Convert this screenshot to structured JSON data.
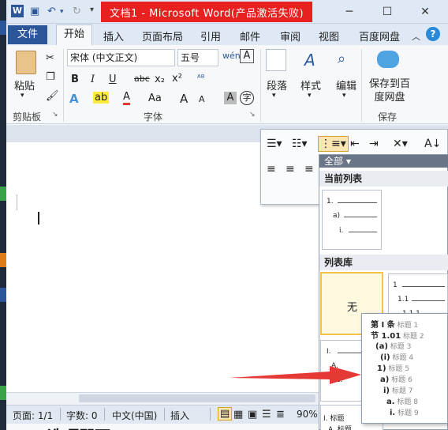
{
  "window": {
    "title": "文档1 - Microsoft Word(产品激活失败)"
  },
  "tabs": {
    "file": "文件",
    "home": "开始",
    "insert": "插入",
    "layout": "页面布局",
    "references": "引用",
    "mailings": "邮件",
    "review": "审阅",
    "view": "视图",
    "baidu": "百度网盘"
  },
  "clipboard": {
    "paste": "粘贴",
    "group": "剪贴板"
  },
  "font": {
    "name": "宋体 (中文正文)",
    "size": "五号",
    "group": "字体",
    "bold": "B",
    "italic": "I",
    "underline": "U",
    "strike": "abc",
    "sub": "x₂",
    "sup": "x²",
    "case": "Aa",
    "grow": "A",
    "shrink": "A",
    "char_border": "A",
    "enclose": "字"
  },
  "groups": {
    "paragraph": "段落",
    "styles": "样式",
    "editing": "编辑",
    "save_baidu": "保存到百度网盘",
    "save_group": "保存"
  },
  "dropdown": {
    "filter": "全部",
    "current_section": "当前列表",
    "library_section": "列表库",
    "none": "无",
    "current_preview": [
      "1.",
      "a)",
      "i."
    ],
    "lib2_preview": [
      "1",
      "1.1",
      "1.1.1"
    ],
    "lib3_preview": [
      "I.",
      "A.",
      "1."
    ],
    "lib4_preview": [
      "I. 标题",
      "A. 标题"
    ]
  },
  "flyout": {
    "lines": [
      {
        "num": "第 Ⅰ 条",
        "label": "标题 1"
      },
      {
        "num": "节 1.01",
        "label": "标题 2"
      },
      {
        "num": "(a)",
        "label": "标题 3"
      },
      {
        "num": "(i)",
        "label": "标题 4"
      },
      {
        "num": "1)",
        "label": "标题 5"
      },
      {
        "num": "a)",
        "label": "标题 6"
      },
      {
        "num": "i)",
        "label": "标题 7"
      },
      {
        "num": "a.",
        "label": "标题 8"
      },
      {
        "num": "i.",
        "label": "标题 9"
      }
    ]
  },
  "status": {
    "page": "页面: 1/1",
    "words": "字数: 0",
    "lang": "中文(中国)",
    "mode": "插入",
    "zoom": "90%"
  },
  "bottom_text": "选项即可",
  "colors": {
    "title_red": "#e8201f",
    "accent": "#2b579a",
    "highlight": "#f4c248",
    "arrow": "#e53935"
  }
}
